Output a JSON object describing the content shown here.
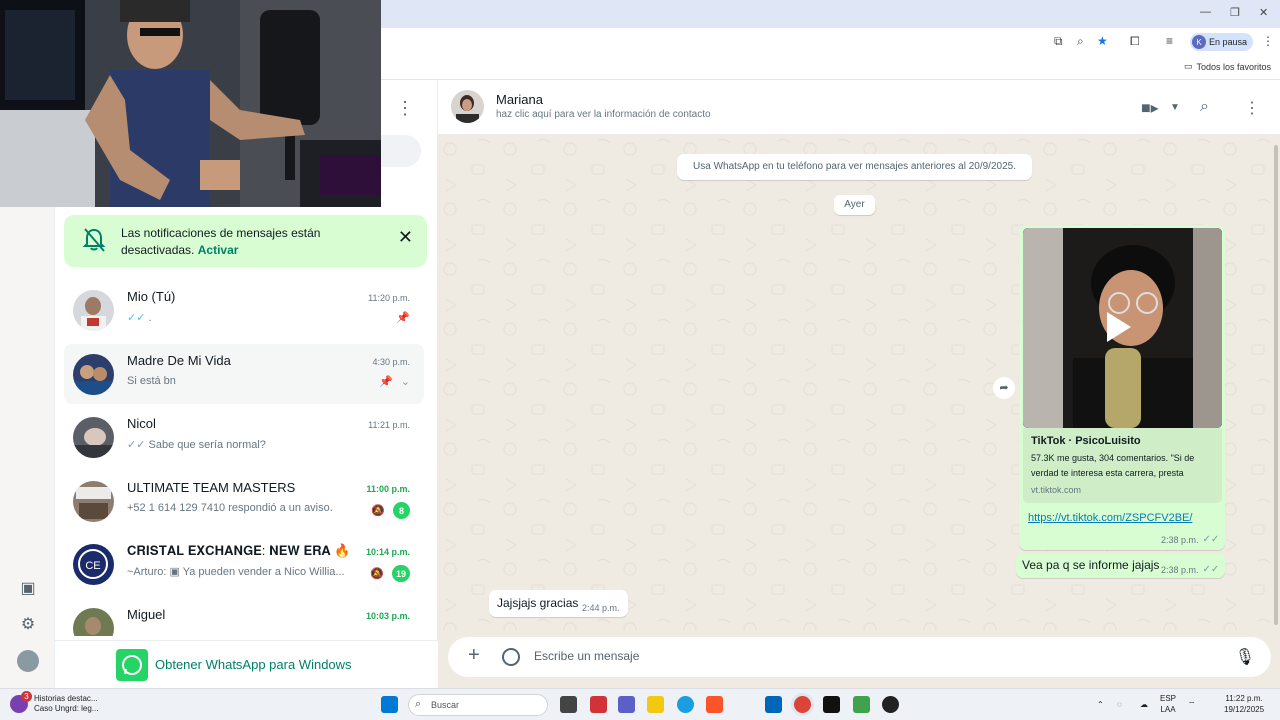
{
  "browser": {
    "profile_initial": "K",
    "profile_status": "En pausa",
    "bookmarks_label": "Todos los favoritos"
  },
  "notification_banner": {
    "text": "Las notificaciones de mensajes están desactivadas.",
    "action": "Activar"
  },
  "chats": [
    {
      "name": "Mio (Tú)",
      "time": "11:20 p.m.",
      "preview": ".",
      "tick": "✓✓",
      "pinned": true
    },
    {
      "name": "Madre De Mi Vida",
      "time": "4:30 p.m.",
      "preview": "Si está bn",
      "pinned": true
    },
    {
      "name": "Nicol",
      "time": "11:21 p.m.",
      "preview": "Sabe que sería normal?",
      "tick": "✓✓"
    },
    {
      "name": "ULTIMATE TEAM MASTERS",
      "time": "11:00 p.m.",
      "preview": "+52 1 614 129 7410 respondió a un aviso.",
      "unread": "8"
    },
    {
      "name": "𝐂𝐑𝐈𝐒𝐓𝐀𝐋 𝐄𝐗𝐂𝐇𝐀𝐍𝐆𝐄: 𝐍𝐄𝐖 𝐄𝐑𝐀 🔥",
      "time": "10:14 p.m.",
      "preview": "~Arturo: ▣ Ya pueden vender a Nico Willia...",
      "unread": "19"
    },
    {
      "name": "Miguel",
      "time": "10:03 p.m.",
      "preview": ""
    }
  ],
  "get_whatsapp": "Obtener WhatsApp para Windows",
  "conversation": {
    "contact_name": "Mariana",
    "contact_sub": "haz clic aquí para ver la información de contacto",
    "system_message": "Usa WhatsApp en tu teléfono para ver mensajes anteriores al 20/9/2025.",
    "day_label": "Ayer",
    "link_message": {
      "preview_title": "TikTok · PsicoLuisito",
      "preview_desc": "57.3K me gusta, 304 comentarios. \"Si de verdad te interesa esta carrera, presta",
      "preview_domain": "vt.tiktok.com",
      "url": "https://vt.tiktok.com/ZSPCFV2BE/",
      "time": "2:38 p.m."
    },
    "out_message": {
      "text": "Vea pa q se informe jajajs",
      "time": "2:38 p.m."
    },
    "in_message": {
      "text": "Jajsjajs gracias",
      "time": "2:44 p.m."
    },
    "compose_placeholder": "Escribe un mensaje"
  },
  "taskbar": {
    "news_badge": "3",
    "news_line1": "Historias destac...",
    "news_line2": "Caso Ungrd: leg...",
    "search_label": "Buscar",
    "lang_line1": "ESP",
    "lang_line2": "LAA",
    "clock_time": "11:22 p.m.",
    "clock_date": "19/12/2025"
  },
  "colors": {
    "wa_green": "#25d366",
    "bubble_out": "#d9fdd3",
    "chat_bg": "#efeae2",
    "link": "#027eb5"
  }
}
